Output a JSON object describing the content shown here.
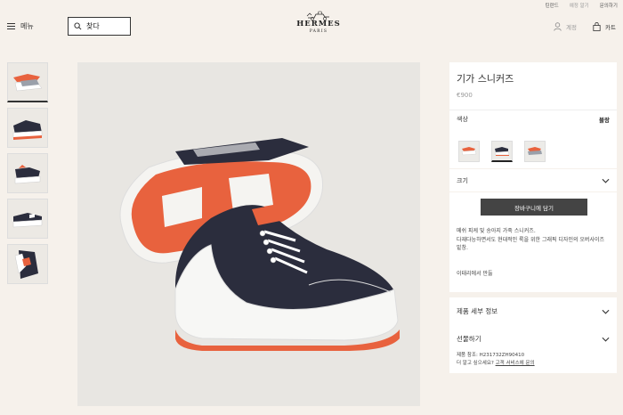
{
  "topbar": {
    "links": [
      "틴란드",
      "예정 알기",
      "문의하기"
    ]
  },
  "header": {
    "menu_label": "메뉴",
    "search_placeholder": "찾다",
    "brand": "HERMES",
    "brand_city": "PARIS",
    "account_label": "계정",
    "cart_label": "카트"
  },
  "product": {
    "name": "기가 스니커즈",
    "price": "€900",
    "color_label": "색상",
    "color_value": "블랑",
    "size_label": "크기",
    "add_to_cart": "장바구니에 담기",
    "description_1": "메쉬 피케 및 송아지 가죽 스니커즈.",
    "description_2": "다재다능하면서도 현대적인 룩을 위한 그래픽 디자인의 오버사이즈 밑창.",
    "origin": "이태리에서 만듦",
    "details_label": "제품 세부 정보",
    "gift_label": "선물하기",
    "ref_text": "제품 참조: H231732ZH90410",
    "help_prefix": "더 알고 싶으세요?",
    "help_link": "고객 서비스에 문의"
  },
  "colors": {
    "accent_orange": "#e8623e",
    "navy": "#2b2d3d",
    "dark_button": "#444444"
  },
  "icons": {
    "menu": "hamburger-icon",
    "search": "search-icon",
    "account": "user-icon",
    "cart": "bag-icon",
    "expand": "chevron-down-icon"
  }
}
